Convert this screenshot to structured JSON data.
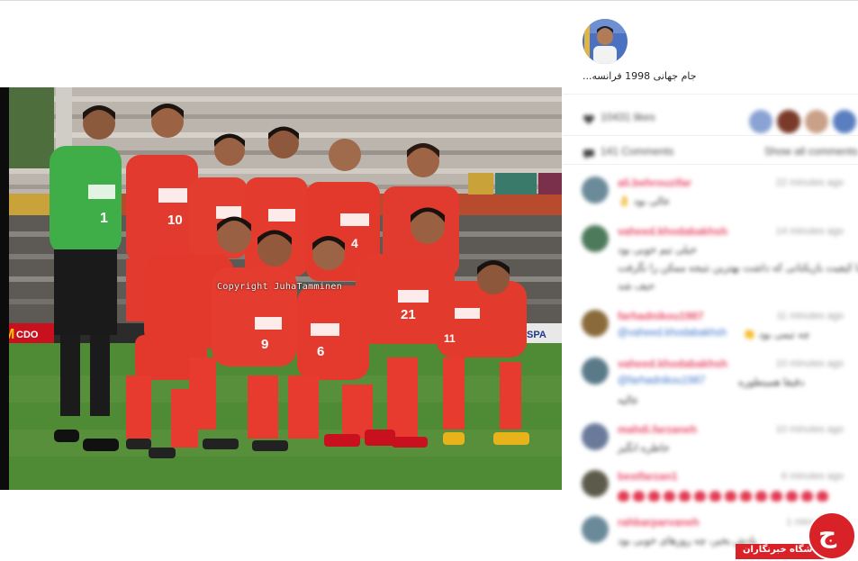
{
  "post": {
    "caption": "جام جهانی 1998 فرانسه...",
    "photo_watermark": "Copyright JuhaTamminen",
    "likes_text": "10431 likes",
    "comments_count_text": "141 Comments",
    "show_all_comments_text": "Show all comments"
  },
  "comments": [
    {
      "username": "ali.behrouzifar",
      "time": "22 minutes ago",
      "lines": [
        "عالی بود 👌"
      ]
    },
    {
      "username": "vaheed.khodabakhsh",
      "time": "14 minutes ago",
      "lines": [
        "خیلی تیم خوبی بود",
        "این تیم با کیفیت بازیکنانی که داشت بهترین نتیجه ممکن را نگرفت",
        "حیف شد"
      ]
    },
    {
      "username": "farhadnikou1987",
      "time": "11 minutes ago",
      "mention": "@vaheed.khodabakhsh",
      "lines": [
        "چه تیمی بود 👏"
      ]
    },
    {
      "username": "vaheed.khodabakhsh",
      "time": "10 minutes ago",
      "mention": "@farhadnikou1987",
      "lines": [
        "دقیقا همینطوره",
        "عالیه"
      ]
    },
    {
      "username": "mahdi.farzaneh",
      "time": "10 minutes ago",
      "lines": [
        "خاطره انگیز"
      ]
    },
    {
      "username": "bestfarzan1",
      "time": "6 minutes ago",
      "hearts": 14,
      "lines": []
    },
    {
      "username": "rahbarparvaneh",
      "time": "1 minute ago",
      "lines": [
        "یادش بخیر، چه روزهای خوبی بود"
      ]
    }
  ],
  "brand": {
    "logo_text": "باشگاه خبرنگاران",
    "accent": "#d92128",
    "username_color": "#e84b6a",
    "mention_color": "#3b74c9"
  },
  "icons": [
    "heart-icon",
    "comment-icon"
  ]
}
